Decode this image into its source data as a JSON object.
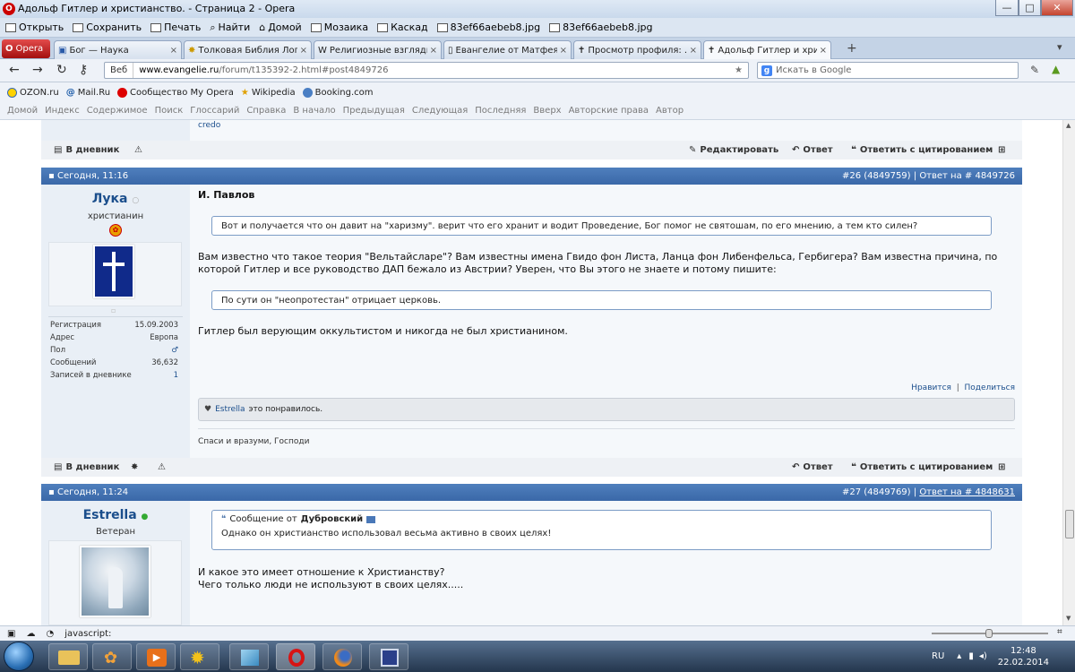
{
  "window": {
    "title": "Адольф Гитлер и христианство. - Страница 2 - Opera",
    "min": "—",
    "max": "□",
    "close": "✕"
  },
  "menu": [
    "Открыть",
    "Сохранить",
    "Печать",
    "Найти",
    "Домой",
    "Мозаика",
    "Каскад",
    "83ef66aebeb8.jpg",
    "83ef66aebeb8.jpg"
  ],
  "opera_button": "Opera",
  "tabs": [
    {
      "label": "Бог — Наука"
    },
    {
      "label": "Толковая Библия Лоп..."
    },
    {
      "label": "Религиозные взгляды ..."
    },
    {
      "label": "Евангелие от Матфея ..."
    },
    {
      "label": "Просмотр профиля: ..."
    },
    {
      "label": "Адольф Гитлер и хрис..."
    }
  ],
  "address": {
    "web_label": "Веб",
    "url_host": "www.evangelie.ru",
    "url_path": "/forum/t135392-2.html#post4849726",
    "search_placeholder": "Искать в Google"
  },
  "bookmarks": [
    "OZON.ru",
    "Mail.Ru",
    "Сообщество My Opera",
    "Wikipedia",
    "Booking.com"
  ],
  "nav_links": [
    "Домой",
    "Индекс",
    "Содержимое",
    "Поиск",
    "Глоссарий",
    "Справка",
    "В начало",
    "Предыдущая",
    "Следующая",
    "Последняя",
    "Вверх",
    "Авторские права",
    "Автор"
  ],
  "top_fragment": {
    "text": "credo",
    "diary": "В дневник",
    "edit": "Редактировать",
    "reply": "Ответ",
    "reply_quote": "Ответить с цитированием"
  },
  "post1": {
    "date": "Сегодня, 11:16",
    "number": "#26 (4849759)",
    "reply_to": "Ответ на # 4849726",
    "author": "Лука",
    "author_title": "христианин",
    "stats": [
      {
        "label": "Регистрация",
        "value": "15.09.2003"
      },
      {
        "label": "Адрес",
        "value": "Европа"
      },
      {
        "label": "Пол",
        "value": "♂"
      },
      {
        "label": "Сообщений",
        "value": "36,632"
      },
      {
        "label": "Записей в дневнике",
        "value": "1"
      }
    ],
    "quoted_name": "И. Павлов",
    "quote1": "Вот и получается что он давит на \"харизму\". верит что его хранит и водит Проведение, Бог помог не святошам, по его мнению, а тем кто силен?",
    "para1_line1": "Вам известно что такое теория \"Вельтайсларе\"? Вам известны имена Гвидо фон Листа, Ланца фон Либенфельса, Гербигера? Вам известна причина, по",
    "para1_line2": "которой Гитлер и все руководство ДАП бежало из Австрии? Уверен, что Вы этого не знаете и потому пишите:",
    "quote2": "По сути он \"неопротестан\" отрицает церковь.",
    "para2": "Гитлер был верующим оккультистом и никогда не был христианином.",
    "like": "Нравится",
    "share": "Поделиться",
    "liked_by": "Estrella",
    "liked_text": "это понравилось.",
    "signature": "Спаси и вразуми, Господи",
    "diary": "В дневник",
    "reply": "Ответ",
    "reply_quote": "Ответить с цитированием"
  },
  "post2": {
    "date": "Сегодня, 11:24",
    "number": "#27 (4849769)",
    "reply_to": "Ответ на # 4848631",
    "author": "Estrella",
    "author_title": "Ветеран",
    "quote_header": "Сообщение от",
    "quote_author": "Дубровский",
    "quote_text": "Однако он христианство использовал весьма активно в своих целях!",
    "line1": "И какое это имеет отношение к Христианству?",
    "line2": "Чего только люди не используют в своих целях....."
  },
  "status_text": "javascript:",
  "tray": {
    "lang": "RU",
    "time": "12:48",
    "date": "22.02.2014"
  },
  "colors": {
    "post_header": "#3a68a8",
    "link": "#1b4e8c",
    "user_pane": "#e9eff6"
  }
}
